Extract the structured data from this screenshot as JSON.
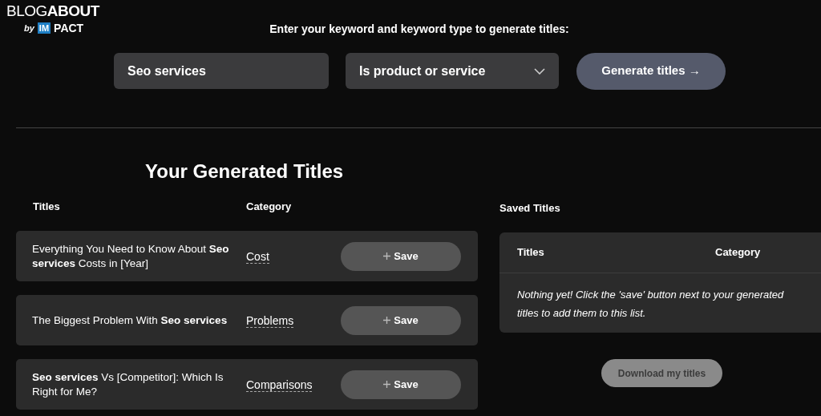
{
  "logo": {
    "name": "BLOG**ABOUT**",
    "by": "by",
    "brand_mark": "IM",
    "brand": "PACT"
  },
  "prompt": "Enter your keyword and keyword type to generate titles:",
  "keyword_field": {
    "value": "Seo services"
  },
  "type_select": {
    "value": "Is product or service"
  },
  "generate_button": {
    "label": "Generate titles",
    "arrow": "→"
  },
  "heading": "Your Generated Titles",
  "generated": {
    "columns": [
      "Titles",
      "Category"
    ],
    "rows": [
      {
        "title": "Everything You Need to Know About **Seo services** Costs in [Year]",
        "category": "Cost",
        "button": "Save"
      },
      {
        "title": "The Biggest Problem With **Seo services**",
        "category": "Problems",
        "button": "Save"
      },
      {
        "title": "**Seo services** Vs [Competitor]: Which Is Right for Me?",
        "category": "Comparisons",
        "button": "Save"
      }
    ]
  },
  "saved": {
    "heading": "Saved Titles",
    "columns": [
      "Titles",
      "Category"
    ],
    "empty_message": "Nothing yet! Click the 'save' button next to your generated titles to add them to this list."
  },
  "download_button": {
    "label": "Download my titles",
    "disabled": true
  }
}
